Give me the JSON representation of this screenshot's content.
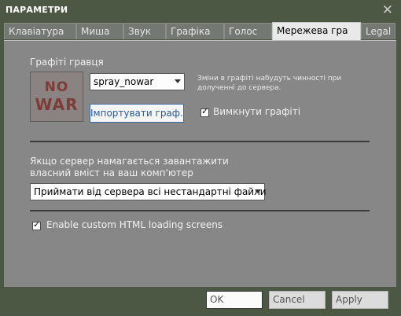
{
  "window": {
    "title": "ПАРАМЕТРИ",
    "close_glyph": "✕"
  },
  "tabs": [
    {
      "label": "Клавіатура",
      "active": false
    },
    {
      "label": "Миша",
      "active": false
    },
    {
      "label": "Звук",
      "active": false
    },
    {
      "label": "Графіка",
      "active": false
    },
    {
      "label": "Голос",
      "active": false
    },
    {
      "label": "Мережева гра",
      "active": true
    },
    {
      "label": "Legal",
      "active": false
    }
  ],
  "graffiti": {
    "label": "Графіті гравця",
    "preview_text_top": "NO",
    "preview_text_bottom": "WAR",
    "selected": "spray_nowar",
    "import_label": "Імпортувати граф...",
    "note": "Зміни в графіті набудуть чинності при долученні до сервера.",
    "disable_label": "Вимкнути графіті",
    "disable_checked": true
  },
  "server_content": {
    "label": "Якщо сервер намагається завантажити власний вміст на ваш комп'ютер",
    "selected": "Приймати від сервера всі нестандартні файли"
  },
  "html_loading": {
    "label": "Enable custom HTML loading screens",
    "checked": true
  },
  "buttons": {
    "ok": "OK",
    "cancel": "Cancel",
    "apply": "Apply"
  },
  "colors": {
    "frame": "#4c5844",
    "panel": "#878787",
    "active_tab": "#e9e9e9",
    "import_text": "#2a5aa0"
  }
}
